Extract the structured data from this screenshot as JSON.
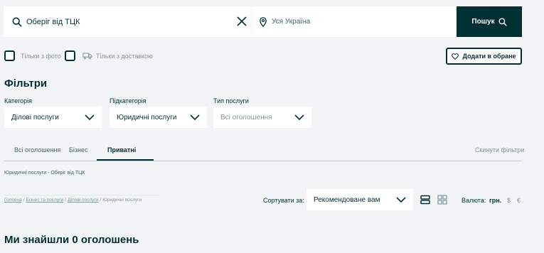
{
  "search": {
    "query": "Оберіг від ТЦК",
    "location_placeholder": "Уся Україна",
    "button_label": "Пошук"
  },
  "options": {
    "photo_only": "Тільки з фото",
    "delivery_only": "Тільки з доставкою",
    "favorite_button": "Додати в обране"
  },
  "filters": {
    "title": "Фільтри",
    "category": {
      "label": "Категорія",
      "value": "Ділові послуги"
    },
    "subcategory": {
      "label": "Підкатегорія",
      "value": "Юридичні послуги"
    },
    "service_type": {
      "label": "Тип послуги",
      "value": "Всі оголошення"
    }
  },
  "tabs": [
    {
      "label": "Всі оголошення"
    },
    {
      "label": "Бізнес"
    },
    {
      "label": "Приватні"
    }
  ],
  "reset_filters": "Скинути фільтри",
  "page_subtitle": "Юридичні послуги - Оберіг від ТЦК",
  "breadcrumb": {
    "items": [
      "Головна",
      "Бізнес та послуги",
      "Ділові послуги"
    ],
    "current": "Юридичні послуги",
    "separator": "/"
  },
  "sort": {
    "label": "Сортувати за:",
    "value": "Рекомендоване вам"
  },
  "currency": {
    "label": "Валюта:",
    "options": [
      "грн.",
      "$",
      "€"
    ]
  },
  "results_heading": "Ми знайшли 0 оголошень",
  "colors": {
    "primary": "#002f34",
    "background": "#f2f4f5",
    "muted": "#7f9799"
  }
}
